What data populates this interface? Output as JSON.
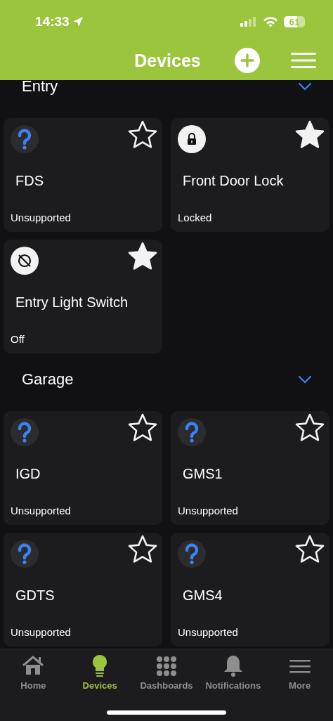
{
  "status_bar": {
    "time": "14:33",
    "battery": "61"
  },
  "header": {
    "title": "Devices"
  },
  "sections": [
    {
      "name": "Entry",
      "expanded": true,
      "devices": [
        {
          "name": "FDS",
          "status": "Unsupported",
          "kind": "unsupported",
          "favorite": false
        },
        {
          "name": "Front Door Lock",
          "status": "Locked",
          "kind": "lock",
          "favorite": true
        },
        {
          "name": "Entry Light Switch",
          "status": "Off",
          "kind": "switch",
          "favorite": true
        }
      ]
    },
    {
      "name": "Garage",
      "expanded": true,
      "devices": [
        {
          "name": "IGD",
          "status": "Unsupported",
          "kind": "unsupported",
          "favorite": false
        },
        {
          "name": "GMS1",
          "status": "Unsupported",
          "kind": "unsupported",
          "favorite": false
        },
        {
          "name": "GDTS",
          "status": "Unsupported",
          "kind": "unsupported",
          "favorite": false
        },
        {
          "name": "GMS4",
          "status": "Unsupported",
          "kind": "unsupported",
          "favorite": false
        }
      ]
    }
  ],
  "tab_bar": [
    {
      "label": "Home",
      "selected": false
    },
    {
      "label": "Devices",
      "selected": true
    },
    {
      "label": "Dashboards",
      "selected": false
    },
    {
      "label": "Notifications",
      "selected": false
    },
    {
      "label": "More",
      "selected": false
    }
  ]
}
